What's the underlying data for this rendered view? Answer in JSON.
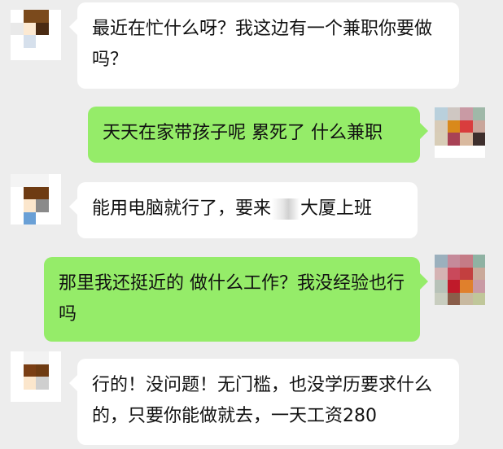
{
  "messages": [
    {
      "side": "left",
      "text": "最近在忙什么呀？我这边有一个兼职你要做吗？"
    },
    {
      "side": "right",
      "text": "天天在家带孩子呢 累死了 什么兼职"
    },
    {
      "side": "left",
      "text_before": "能用电脑就行了，要来",
      "text_after": "大厦上班"
    },
    {
      "side": "right",
      "text": "那里我还挺近的 做什么工作？我没经验也行吗"
    },
    {
      "side": "left",
      "text": "行的！没问题！无门槛，也没学历要求什么的，只要你能做就去，一天工资280"
    }
  ],
  "avatars": {
    "contact_a": [
      "#ffffff",
      "#7b4a1c",
      "#7b4a1c",
      "#ffffff",
      "#e9e9e9",
      "#fce9d2",
      "#4a2a12",
      "#ffffff",
      "#ffffff",
      "#d6e0ec",
      "#ffffff",
      "#ffffff",
      "#ffffff",
      "#ffffff",
      "#ffffff",
      "#ffffff"
    ],
    "self_1": [
      "#b9d0dc",
      "#cfc7c2",
      "#c99aa4",
      "#9fb8a8",
      "#d8cbb7",
      "#d9891b",
      "#d93d3d",
      "#c9a69b",
      "#d8cdb7",
      "#a84255",
      "#d9b99f",
      "#3e2f2d",
      "#ffffff",
      "#ffffff",
      "#ffffff",
      "#ffffff"
    ],
    "contact_b": [
      "#f4f4f4",
      "#f4f4f4",
      "#f4f4f4",
      "#ffffff",
      "#ffffff",
      "#6e3b12",
      "#6e3b12",
      "#ffffff",
      "#ffffff",
      "#fbe6cc",
      "#8a8a8a",
      "#ffffff",
      "#ffffff",
      "#6aa0d6",
      "#ffffff",
      "#ffffff"
    ],
    "self_2": [
      "#9bb0bd",
      "#c58a9a",
      "#c57b86",
      "#8fb2a3",
      "#d5b3b3",
      "#c9495b",
      "#c33f3f",
      "#caa99a",
      "#b7c2b8",
      "#c01a2a",
      "#e0802c",
      "#c99aa4",
      "#c8cdbf",
      "#8a5e4a",
      "#c8b9a0",
      "#c0c79a"
    ],
    "contact_c": [
      "#ffffff",
      "#f2f2f2",
      "#f2f2f2",
      "#ffffff",
      "#ffffff",
      "#7a3e14",
      "#6e3b12",
      "#ffffff",
      "#ffffff",
      "#fbe6cc",
      "#cfcfcf",
      "#ffffff",
      "#ffffff",
      "#ffffff",
      "#ffffff",
      "#ffffff"
    ]
  },
  "colors": {
    "background": "#ededed",
    "incoming_bubble": "#ffffff",
    "outgoing_bubble": "#95ec69"
  }
}
